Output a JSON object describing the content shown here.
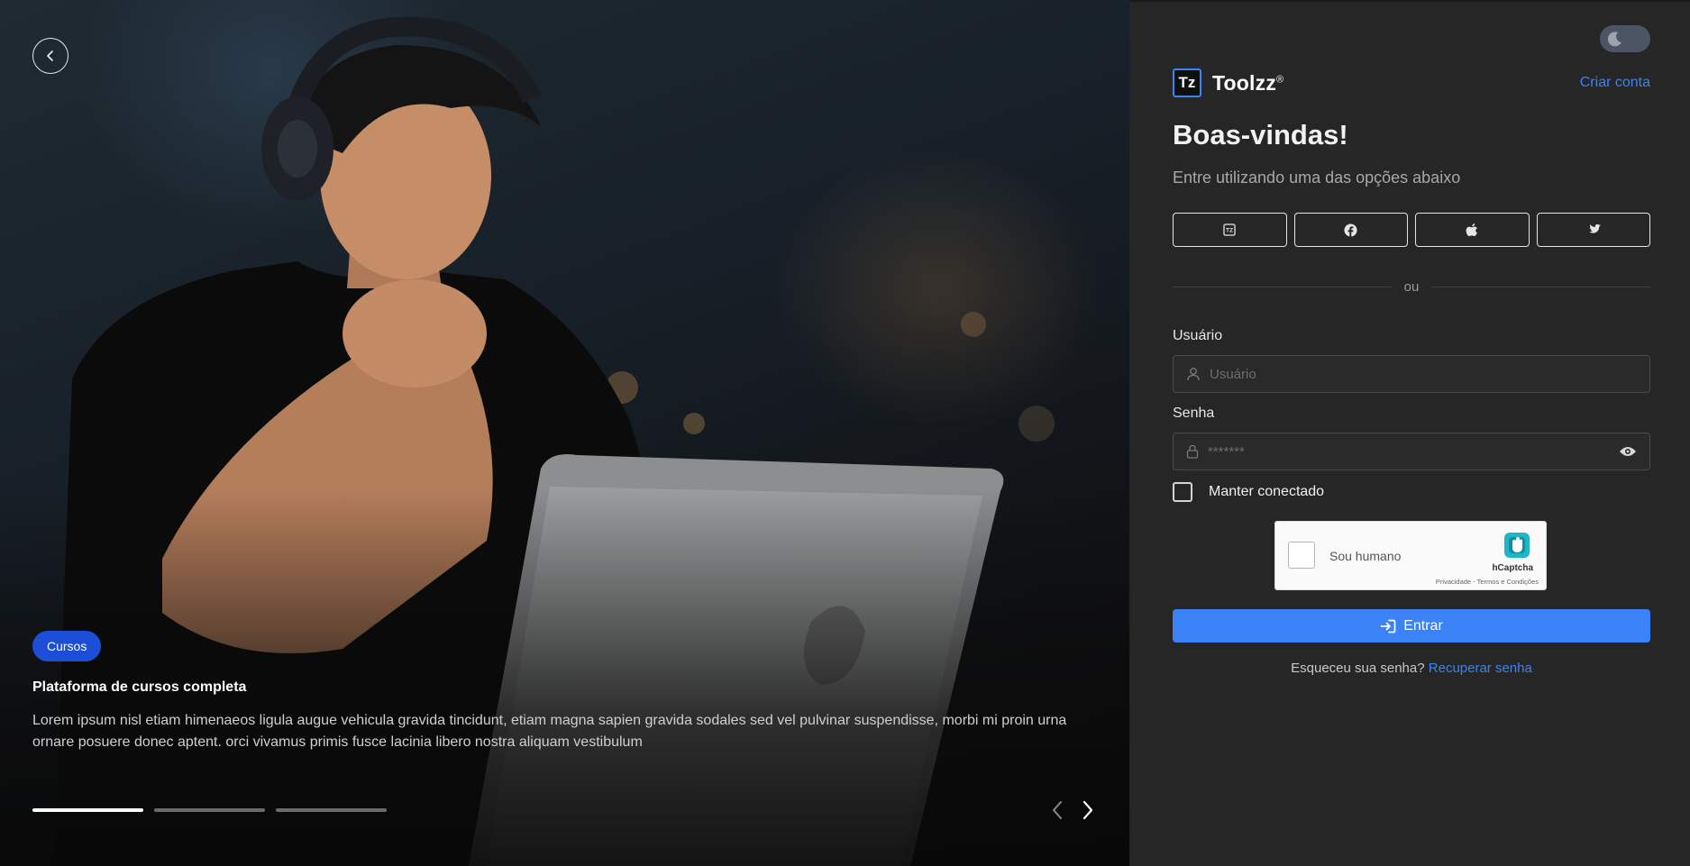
{
  "hero": {
    "tag": "Cursos",
    "title": "Plataforma de cursos completa",
    "description": "Lorem ipsum nisl etiam himenaeos ligula augue vehicula gravida tincidunt, etiam magna sapien gravida sodales sed vel pulvinar suspendisse, morbi mi proin urna ornare posuere donec aptent. orci vivamus primis fusce lacinia libero nostra aliquam vestibulum",
    "slides_total": 3,
    "active_slide": 1
  },
  "brand": {
    "logo_text": "Tz",
    "name": "Toolzz",
    "mark": "®"
  },
  "header": {
    "create_account": "Criar conta"
  },
  "login": {
    "title": "Boas-vindas!",
    "subtitle": "Entre utilizando uma das opções abaixo",
    "social_icons": [
      "toolzz-icon",
      "facebook-icon",
      "apple-icon",
      "twitter-icon"
    ],
    "divider": "ou",
    "user_label": "Usuário",
    "user_placeholder": "Usuário",
    "password_label": "Senha",
    "password_placeholder": "*******",
    "remember": "Manter conectado",
    "submit": "Entrar",
    "forgot_text": "Esqueceu sua senha?",
    "forgot_link": "Recuperar senha"
  },
  "captcha": {
    "label": "Sou humano",
    "brand": "hCaptcha",
    "links": "Privacidade - Termos e Condições"
  },
  "colors": {
    "accent": "#3b82f6",
    "tag": "#1d4ed8",
    "panel": "#262626"
  }
}
